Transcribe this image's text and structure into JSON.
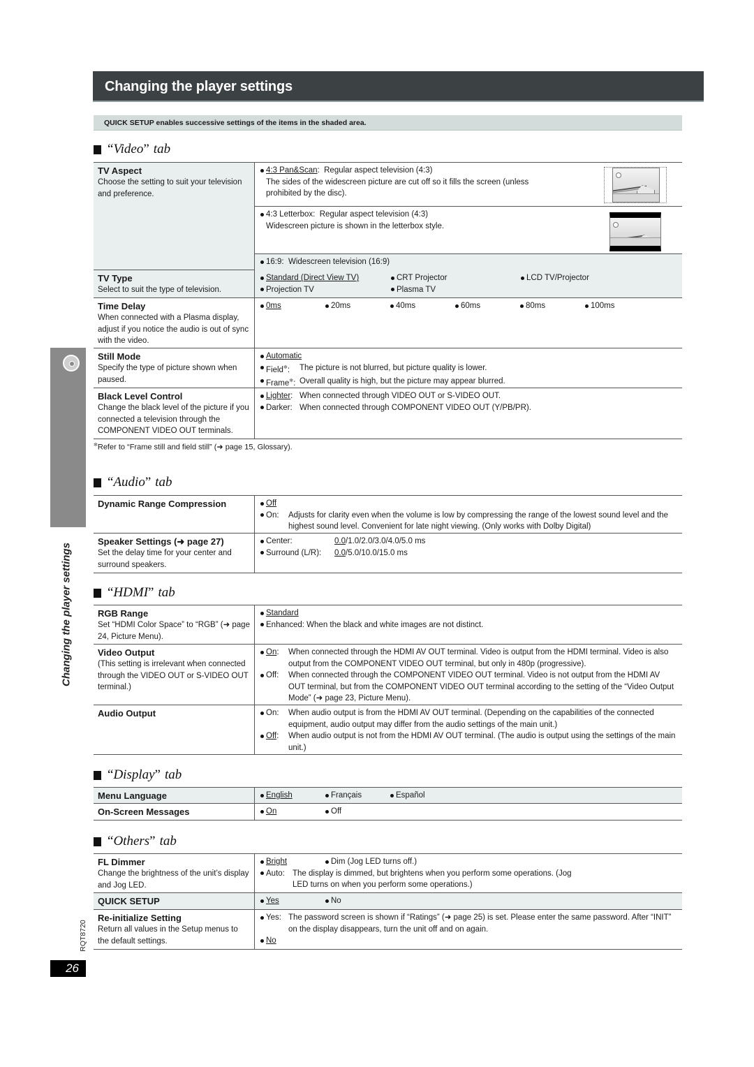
{
  "header": {
    "title": "Changing the player settings"
  },
  "quick_note": "QUICK SETUP enables successive settings of the items in the shaded area.",
  "side_tab": {
    "text": "Changing the player settings",
    "icon": "disc-icon"
  },
  "doc_code": "RQT8720",
  "page_number": "26",
  "tab_word": "tab",
  "video": {
    "title": "Video",
    "tv_aspect": {
      "name": "TV Aspect",
      "desc": "Choose the setting to suit your television and preference.",
      "pan_scan": {
        "label": "4:3 Pan&Scan",
        "text": "Regular aspect television (4:3)",
        "text2": "The sides of the widescreen picture are cut off so it fills the screen (unless prohibited by the disc)."
      },
      "letterbox": {
        "label": "4:3 Letterbox:",
        "text": "Regular aspect television (4:3)",
        "text2": "Widescreen picture is shown in the letterbox style."
      },
      "wide": {
        "label": "16:9:",
        "text": "Widescreen television (16:9)"
      }
    },
    "tv_type": {
      "name": "TV Type",
      "desc": "Select to suit the type of television.",
      "options": [
        "Standard (Direct View TV)",
        "CRT Projector",
        "LCD TV/Projector",
        "Projection TV",
        "Plasma TV"
      ]
    },
    "time_delay": {
      "name": "Time Delay",
      "desc": "When connected with a Plasma display, adjust if you notice the audio is out of sync with the video.",
      "options": [
        "0ms",
        "20ms",
        "40ms",
        "60ms",
        "80ms",
        "100ms"
      ]
    },
    "still_mode": {
      "name": "Still Mode",
      "desc": "Specify the type of picture shown when paused.",
      "automatic": "Automatic",
      "field": {
        "label": "Field",
        "text": "The picture is not blurred, but picture quality is lower."
      },
      "frame": {
        "label": "Frame",
        "text": "Overall quality is high, but the picture may appear blurred."
      }
    },
    "black_level": {
      "name": "Black Level Control",
      "desc": "Change the black level of the picture if you connected a television through the COMPONENT VIDEO OUT terminals.",
      "lighter": {
        "label": "Lighter",
        "text": "When connected through VIDEO OUT or S-VIDEO OUT."
      },
      "darker": {
        "label": "Darker:",
        "text": "When connected through COMPONENT VIDEO OUT (Y/PB/PR)."
      }
    },
    "footnote": "Refer to “Frame still and field still” (➜ page 15, Glossary)."
  },
  "audio": {
    "title": "Audio",
    "drc": {
      "name": "Dynamic Range Compression",
      "off": "Off",
      "on": {
        "label": "On:",
        "text": "Adjusts for clarity even when the volume is low by compressing the range of the lowest sound level and the highest sound level. Convenient for late night viewing. (Only works with Dolby Digital)"
      }
    },
    "speaker": {
      "name": "Speaker Settings (➜ page 27)",
      "desc": "Set the delay time for your center and surround speakers.",
      "center": {
        "label": "Center:",
        "default": "0.0",
        "rest": "/1.0/2.0/3.0/4.0/5.0 ms"
      },
      "surround": {
        "label": "Surround (L/R):",
        "default": "0.0",
        "rest": "/5.0/10.0/15.0 ms"
      }
    }
  },
  "hdmi": {
    "title": "HDMI",
    "rgb": {
      "name": "RGB Range",
      "desc": "Set “HDMI Color Space” to “RGB” (➜ page 24, Picture Menu).",
      "standard": "Standard",
      "enhanced": "Enhanced: When the black and white images are not distinct."
    },
    "video_output": {
      "name": "Video Output",
      "desc": "(This setting is irrelevant when connected through the VIDEO OUT or S-VIDEO OUT terminal.)",
      "on": {
        "label": "On",
        "text": "When connected through the HDMI AV OUT terminal. Video is output from the HDMI terminal. Video is also output from the COMPONENT VIDEO OUT terminal, but only in 480p (progressive)."
      },
      "off": {
        "label": "Off:",
        "text": "When connected through the COMPONENT VIDEO OUT terminal. Video is not output from the HDMI AV OUT terminal, but from the COMPONENT VIDEO OUT terminal according to the setting of the “Video Output Mode” (➜ page 23, Picture Menu)."
      }
    },
    "audio_output": {
      "name": "Audio Output",
      "on": {
        "label": "On:",
        "text": "When audio output is from the HDMI AV OUT terminal. (Depending on the capabilities of the connected equipment, audio output may differ from the audio settings of the main unit.)"
      },
      "off": {
        "label": "Off",
        "text": "When audio output is not from the HDMI AV OUT terminal. (The audio is output using the settings of the main unit.)"
      }
    }
  },
  "display": {
    "title": "Display",
    "menu_language": {
      "name": "Menu Language",
      "options": [
        "English",
        "Français",
        "Español"
      ]
    },
    "osd": {
      "name": "On-Screen Messages",
      "options": [
        "On",
        "Off"
      ]
    }
  },
  "others": {
    "title": "Others",
    "fl_dimmer": {
      "name": "FL Dimmer",
      "desc": "Change the brightness of the unit’s display and Jog LED.",
      "bright": "Bright",
      "dim": "Dim (Jog LED turns off.)",
      "auto": {
        "label": "Auto:",
        "text": "The display is dimmed, but brightens when you perform some operations. (Jog LED turns on when you perform some operations.)"
      }
    },
    "quick_setup": {
      "name": "QUICK SETUP",
      "options": [
        "Yes",
        "No"
      ]
    },
    "reinit": {
      "name": "Re-initialize Setting",
      "desc": "Return all values in the Setup menus to the default settings.",
      "yes": {
        "label": "Yes:",
        "text": "The password screen is shown if “Ratings” (➜ page 25) is set. Please enter the same password. After “INIT” on the display disappears, turn the unit off and on again."
      },
      "no": "No"
    }
  },
  "colors": {
    "header_bg": "#3c4143",
    "shade": "#e9eeee",
    "note_bg": "#d3dcdb",
    "side_tab": "#8a8a8a"
  }
}
